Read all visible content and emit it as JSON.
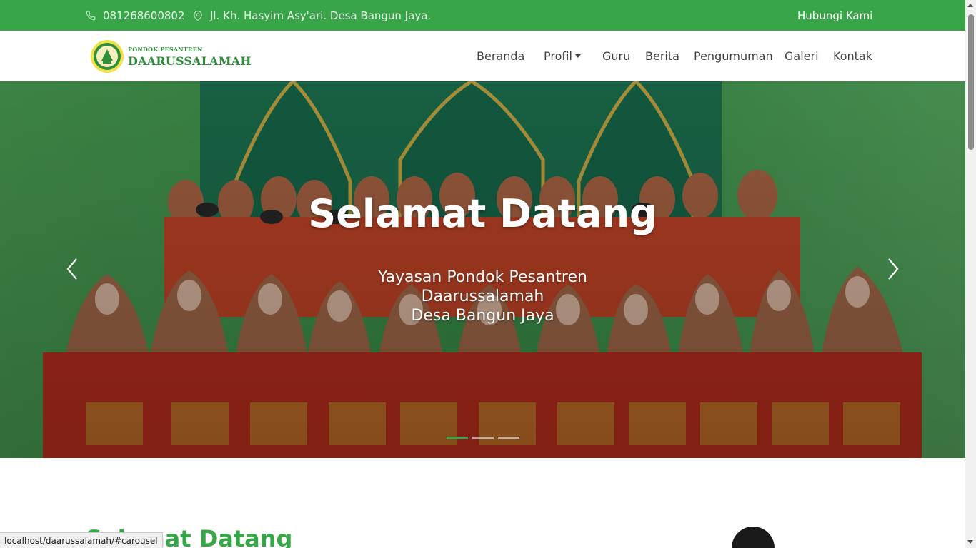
{
  "topbar": {
    "phone": "081268600802",
    "address": "Jl. Kh. Hasyim Asy'ari. Desa Bangun Jaya.",
    "contact_link": "Hubungi Kami"
  },
  "logo": {
    "line1": "PONDOK PESANTREN",
    "line2": "DAARUSSALAMAH"
  },
  "nav": {
    "items": [
      "Beranda",
      "Profil",
      "Guru",
      "Berita",
      "Pengumuman",
      "Galeri",
      "Kontak"
    ]
  },
  "hero": {
    "title": "Selamat Datang",
    "subtitle_line1": "Yayasan Pondok Pesantren",
    "subtitle_line2": "Daarussalamah",
    "subtitle_line3": "Desa Bangun Jaya",
    "active_slide": 1,
    "slide_count": 3
  },
  "section": {
    "heading": "Selamat Datang"
  },
  "statusbar": {
    "url": "localhost/daarussalamah/#carousel"
  },
  "colors": {
    "primary": "#37a548",
    "nav_text": "#404040",
    "white": "#ffffff"
  },
  "icons": {
    "phone": "phone-icon",
    "location": "map-pin-icon",
    "prev": "chevron-left-icon",
    "next": "chevron-right-icon"
  }
}
